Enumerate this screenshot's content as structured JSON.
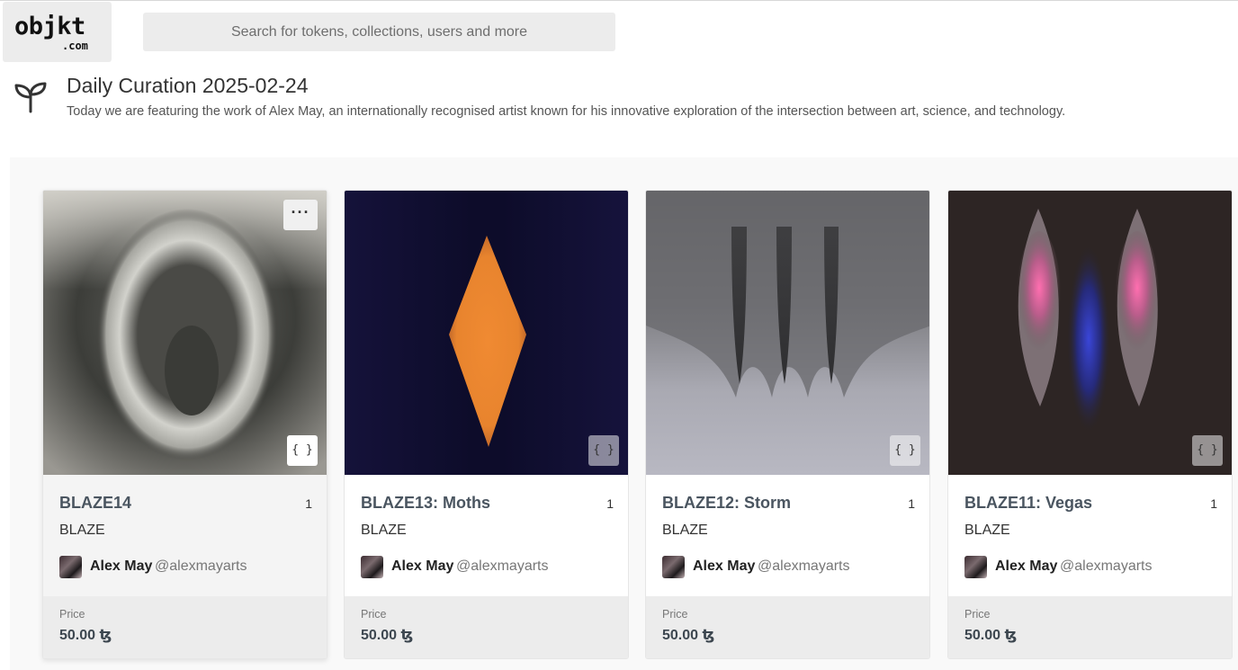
{
  "header": {
    "logo_main": "objkt",
    "logo_sub": ".com",
    "search_placeholder": "Search for tokens, collections, users and more"
  },
  "curation": {
    "title": "Daily Curation 2025-02-24",
    "description": "Today we are featuring the work of Alex May, an internationally recognised artist known for his innovative exploration of the intersection between art, science, and technology.",
    "icon": "sprout-icon"
  },
  "cards": [
    {
      "name": "BLAZE14",
      "edition": "1",
      "collection": "BLAZE",
      "artist_name": "Alex May",
      "artist_handle": "@alexmayarts",
      "price_label": "Price",
      "price": "50.00 ꜩ",
      "menu_label": "···",
      "code_label": "{ }"
    },
    {
      "name": "BLAZE13: Moths",
      "edition": "1",
      "collection": "BLAZE",
      "artist_name": "Alex May",
      "artist_handle": "@alexmayarts",
      "price_label": "Price",
      "price": "50.00 ꜩ",
      "code_label": "{ }"
    },
    {
      "name": "BLAZE12: Storm",
      "edition": "1",
      "collection": "BLAZE",
      "artist_name": "Alex May",
      "artist_handle": "@alexmayarts",
      "price_label": "Price",
      "price": "50.00 ꜩ",
      "code_label": "{ }"
    },
    {
      "name": "BLAZE11: Vegas",
      "edition": "1",
      "collection": "BLAZE",
      "artist_name": "Alex May",
      "artist_handle": "@alexmayarts",
      "price_label": "Price",
      "price": "50.00 ꜩ",
      "code_label": "{ }"
    }
  ]
}
